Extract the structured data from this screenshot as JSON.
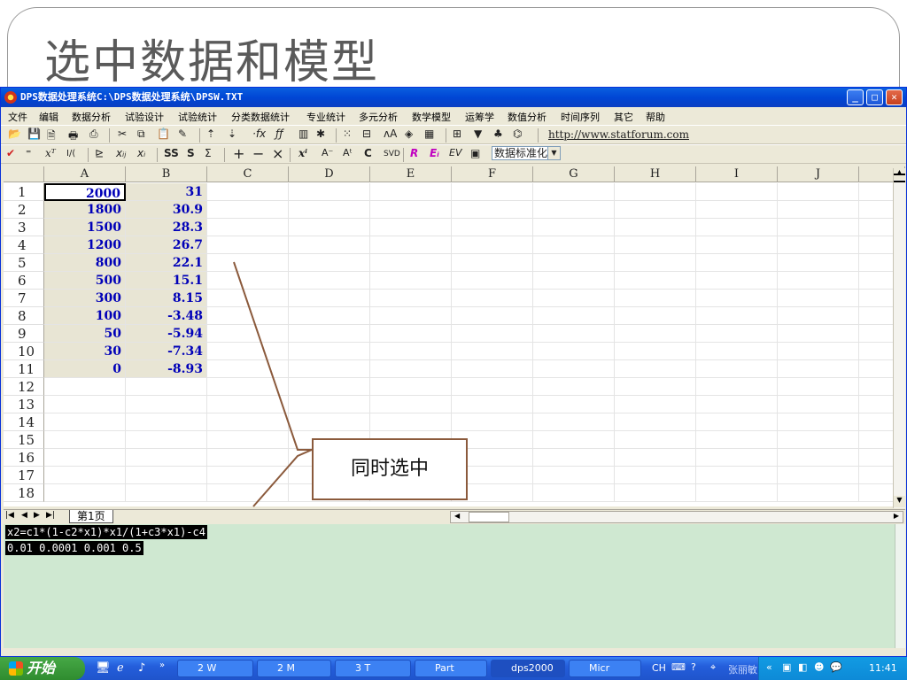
{
  "slide": {
    "title": "选中数据和模型",
    "callout": "同时选中"
  },
  "window": {
    "title": "DPS数据处理系统C:\\DPS数据处理系统\\DPSW.TXT",
    "min_label": "_",
    "max_label": "□",
    "close_label": "✕"
  },
  "menu": [
    "文件",
    "编辑",
    "数据分析",
    "试验设计",
    "试验统计",
    "分类数据统计",
    "专业统计",
    "多元分析",
    "数学模型",
    "运筹学",
    "数值分析",
    "时间序列",
    "其它",
    "帮助"
  ],
  "toolbar1": {
    "url": "http://www.statforum.com"
  },
  "toolbar2": {
    "combo": "数据标准化"
  },
  "grid": {
    "columns": [
      "A",
      "B",
      "C",
      "D",
      "E",
      "F",
      "G",
      "H",
      "I",
      "J"
    ],
    "rows": [
      "1",
      "2",
      "3",
      "4",
      "5",
      "6",
      "7",
      "8",
      "9",
      "10",
      "11",
      "12",
      "13",
      "14",
      "15",
      "16",
      "17",
      "18"
    ],
    "col_a": [
      "2000",
      "1800",
      "1500",
      "1200",
      "800",
      "500",
      "300",
      "100",
      "50",
      "30",
      "0"
    ],
    "col_b": [
      "31",
      "30.9",
      "28.3",
      "26.7",
      "22.1",
      "15.1",
      "8.15",
      "-3.48",
      "-5.94",
      "-7.34",
      "-8.93"
    ]
  },
  "sheet": {
    "tab": "第1页"
  },
  "editor": {
    "line1": "x2=c1*(1-c2*x1)*x1/(1+c3*x1)-c4",
    "line2": "0.01 0.0001 0.001 0.5"
  },
  "taskbar": {
    "start": "开始",
    "tasks": [
      "2 W",
      "2 M",
      "3 T",
      "Part",
      "dps2000",
      "Micr"
    ],
    "ime": "CH",
    "user": "张丽敏",
    "clock": "11:41"
  },
  "colors": {
    "accent": "#0046d5",
    "data_text": "#0000b8",
    "editor_bg": "#cfe8d1",
    "callout_border": "#8b5a3c"
  }
}
